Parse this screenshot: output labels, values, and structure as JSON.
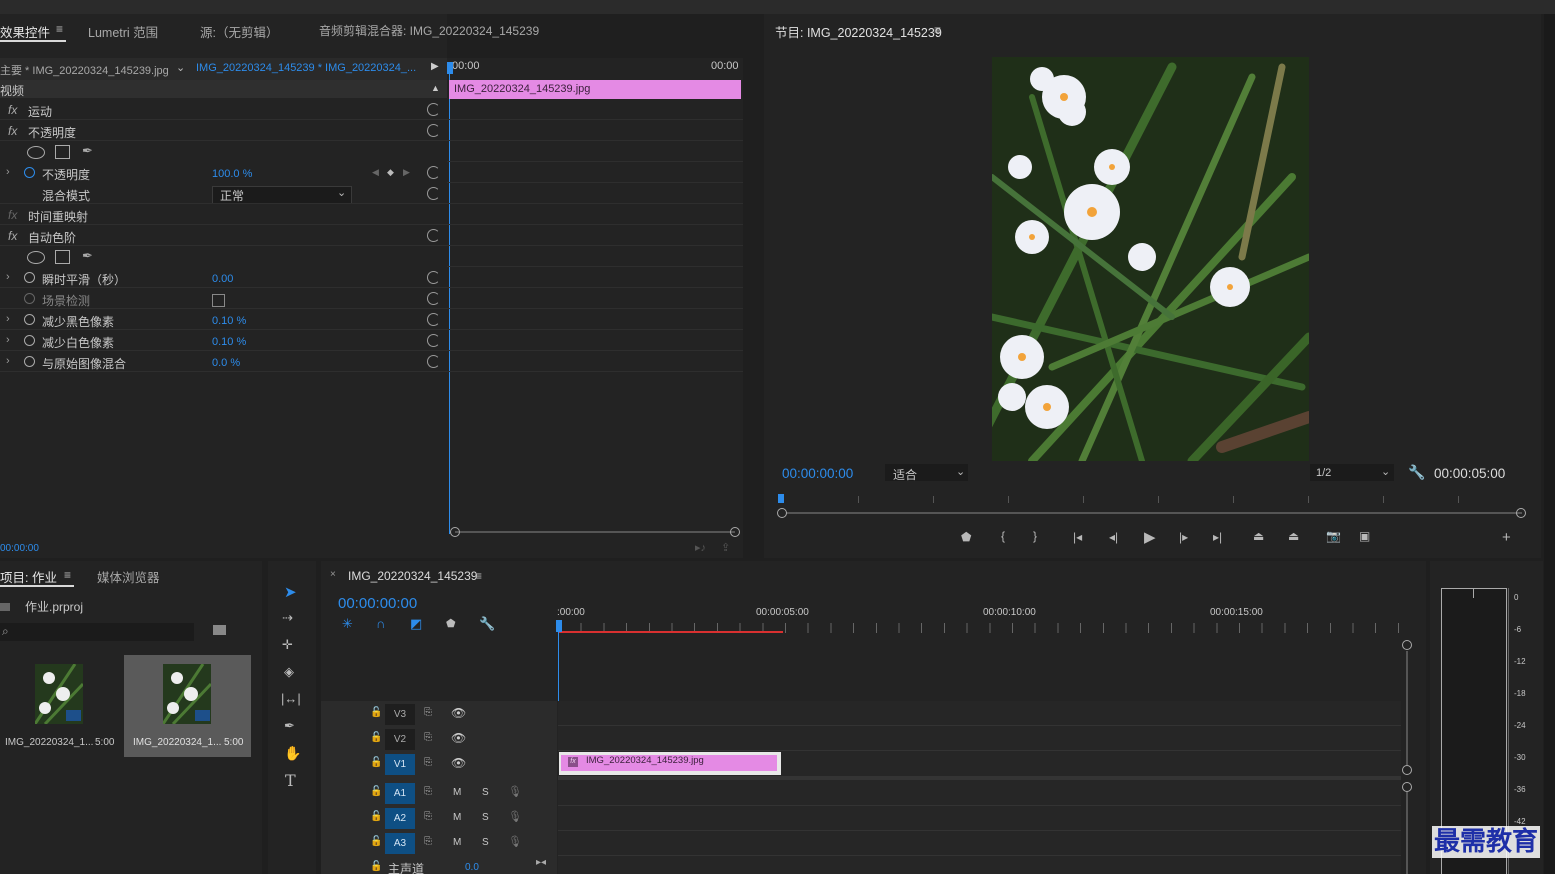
{
  "effects_panel": {
    "tabs": [
      "效果控件",
      "Lumetri 范围",
      "源:（无剪辑）",
      "音频剪辑混合器: IMG_20220324_145239"
    ],
    "master_clip": "主要 * IMG_20220324_145239.jpg",
    "sequence_clip": "IMG_20220324_145239 * IMG_20220324_...",
    "section_video": "视频",
    "time_start": "00:00",
    "time_end": "00:00",
    "clip_bar_label": "IMG_20220324_145239.jpg",
    "footer_time": "00:00:00",
    "effects": {
      "motion": "运动",
      "opacity": "不透明度",
      "opacity_param": "不透明度",
      "opacity_value": "100.0 %",
      "blend_mode_label": "混合模式",
      "blend_mode_value": "正常",
      "time_remap": "时间重映射",
      "auto_levels": "自动色阶",
      "smoothing_label": "瞬时平滑（秒）",
      "smoothing_value": "0.00",
      "scene_detect_label": "场景检测",
      "black_clip_label": "减少黑色像素",
      "black_clip_value": "0.10 %",
      "white_clip_label": "减少白色像素",
      "white_clip_value": "0.10 %",
      "blend_original_label": "与原始图像混合",
      "blend_original_value": "0.0 %"
    }
  },
  "program_monitor": {
    "title": "节目: IMG_20220324_145239",
    "current_time": "00:00:00:00",
    "fit_value": "适合",
    "resolution": "1/2",
    "duration": "00:00:05:00"
  },
  "project_panel": {
    "tabs": [
      "项目: 作业",
      "媒体浏览器"
    ],
    "project_file": "作业.prproj",
    "items": [
      {
        "name": "IMG_20220324_1...",
        "duration": "5:00"
      },
      {
        "name": "IMG_20220324_1...",
        "duration": "5:00"
      }
    ]
  },
  "timeline": {
    "sequence_name": "IMG_20220324_145239",
    "current_time": "00:00:00:00",
    "ruler": [
      ":00:00",
      "00:00:05:00",
      "00:00:10:00",
      "00:00:15:00"
    ],
    "video_tracks": [
      "V3",
      "V2",
      "V1"
    ],
    "audio_tracks": [
      "A1",
      "A2",
      "A3"
    ],
    "mute_label": "M",
    "solo_label": "S",
    "master_label": "主声道",
    "master_value": "0.0",
    "clip_label": "IMG_20220324_145239.jpg",
    "fx_badge": "fx"
  },
  "meter": {
    "scale": [
      "0",
      "-6",
      "-12",
      "-18",
      "-24",
      "-30",
      "-36",
      "-42"
    ]
  },
  "watermark": "最需教育",
  "colors": {
    "accent_blue": "#2d8ceb",
    "clip_pink": "#e48ae4",
    "track_on": "#0e4f84",
    "playhead_red": "#d93030"
  }
}
